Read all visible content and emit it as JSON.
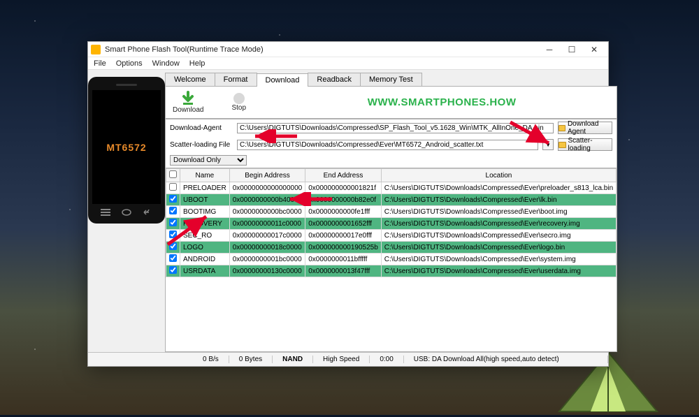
{
  "window": {
    "title": "Smart Phone Flash Tool(Runtime Trace Mode)"
  },
  "menu": {
    "file": "File",
    "options": "Options",
    "window": "Window",
    "help": "Help"
  },
  "phone": {
    "chip": "MT6572"
  },
  "tabs": {
    "welcome": "Welcome",
    "format": "Format",
    "download": "Download",
    "readback": "Readback",
    "memorytest": "Memory Test"
  },
  "toolbar": {
    "download": "Download",
    "stop": "Stop"
  },
  "watermark": "WWW.SMARTPHONES.HOW",
  "fields": {
    "da_label": "Download-Agent",
    "da_value": "C:\\Users\\DIGTUTS\\Downloads\\Compressed\\SP_Flash_Tool_v5.1628_Win\\MTK_AllInOne_DA.bin",
    "scatter_label": "Scatter-loading File",
    "scatter_value": "C:\\Users\\DIGTUTS\\Downloads\\Compressed\\Ever\\MT6572_Android_scatter.txt",
    "mode": "Download Only"
  },
  "buttons": {
    "download_agent": "Download Agent",
    "scatter_loading": "Scatter-loading"
  },
  "table": {
    "headers": {
      "name": "Name",
      "begin": "Begin Address",
      "end": "End Address",
      "location": "Location"
    },
    "rows": [
      {
        "checked": false,
        "green": false,
        "name": "PRELOADER",
        "begin": "0x0000000000000000",
        "end": "0x000000000001821f",
        "location": "C:\\Users\\DIGTUTS\\Downloads\\Compressed\\Ever\\preloader_s813_lca.bin"
      },
      {
        "checked": true,
        "green": true,
        "name": "UBOOT",
        "begin": "0x0000000000b40000",
        "end": "0x0000000000b82e0f",
        "location": "C:\\Users\\DIGTUTS\\Downloads\\Compressed\\Ever\\lk.bin"
      },
      {
        "checked": true,
        "green": false,
        "name": "BOOTIMG",
        "begin": "0x0000000000bc0000",
        "end": "0x0000000000fe1fff",
        "location": "C:\\Users\\DIGTUTS\\Downloads\\Compressed\\Ever\\boot.img"
      },
      {
        "checked": true,
        "green": true,
        "name": "RECOVERY",
        "begin": "0x00000000011c0000",
        "end": "0x0000000001652fff",
        "location": "C:\\Users\\DIGTUTS\\Downloads\\Compressed\\Ever\\recovery.img"
      },
      {
        "checked": true,
        "green": false,
        "name": "SEC_RO",
        "begin": "0x00000000017c0000",
        "end": "0x00000000017e0fff",
        "location": "C:\\Users\\DIGTUTS\\Downloads\\Compressed\\Ever\\secro.img"
      },
      {
        "checked": true,
        "green": true,
        "name": "LOGO",
        "begin": "0x00000000018c0000",
        "end": "0x000000000190525b",
        "location": "C:\\Users\\DIGTUTS\\Downloads\\Compressed\\Ever\\logo.bin"
      },
      {
        "checked": true,
        "green": false,
        "name": "ANDROID",
        "begin": "0x0000000001bc0000",
        "end": "0x0000000011bfffff",
        "location": "C:\\Users\\DIGTUTS\\Downloads\\Compressed\\Ever\\system.img"
      },
      {
        "checked": true,
        "green": true,
        "name": "USRDATA",
        "begin": "0x00000000130c0000",
        "end": "0x0000000013f47fff",
        "location": "C:\\Users\\DIGTUTS\\Downloads\\Compressed\\Ever\\userdata.img"
      }
    ]
  },
  "status": {
    "speed": "0 B/s",
    "bytes": "0 Bytes",
    "storage": "NAND",
    "mode": "High Speed",
    "time": "0:00",
    "usb": "USB: DA Download All(high speed,auto detect)"
  }
}
